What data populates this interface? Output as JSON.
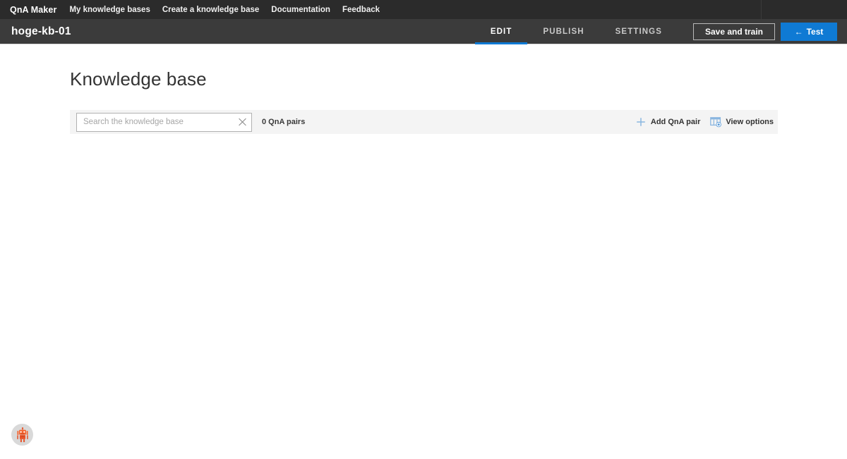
{
  "topnav": {
    "brand": "QnA Maker",
    "links": [
      {
        "label": "My knowledge bases"
      },
      {
        "label": "Create a knowledge base"
      },
      {
        "label": "Documentation"
      },
      {
        "label": "Feedback"
      }
    ]
  },
  "kbheader": {
    "kb_name": "hoge-kb-01",
    "tabs": [
      {
        "label": "EDIT",
        "active": true
      },
      {
        "label": "PUBLISH",
        "active": false
      },
      {
        "label": "SETTINGS",
        "active": false
      }
    ],
    "save_label": "Save and train",
    "test_label": "Test",
    "test_arrow": "←",
    "accent_color": "#0f7ad4"
  },
  "page": {
    "title": "Knowledge base"
  },
  "toolbar": {
    "search_placeholder": "Search the knowledge base",
    "search_value": "",
    "clear_icon": "close-icon",
    "pairs_count": "0 QnA pairs",
    "add_pair_label": "Add QnA pair",
    "add_pair_icon": "plus-icon",
    "view_options_label": "View options",
    "view_options_icon": "table-settings-icon",
    "icon_color": "#8ab6e0"
  },
  "avatar": {
    "name": "chat-bot-avatar",
    "color": "#e8542a"
  }
}
